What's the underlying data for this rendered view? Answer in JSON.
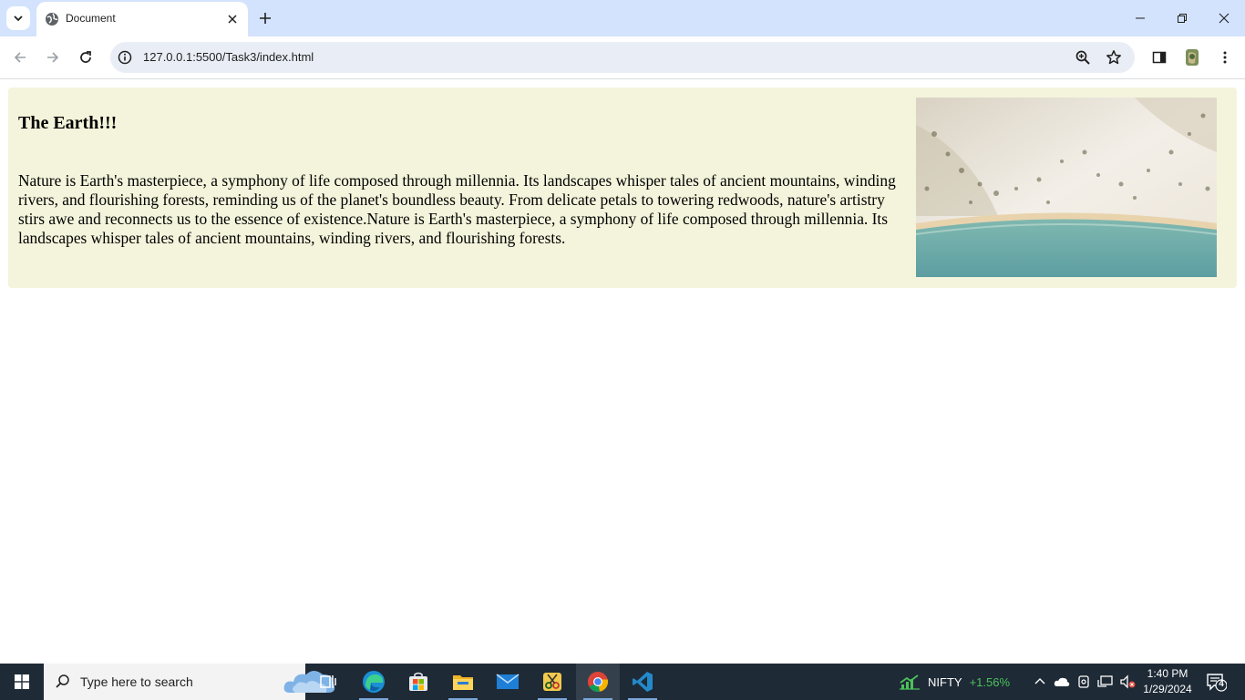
{
  "browser": {
    "tab_title": "Document",
    "url": "127.0.0.1:5500/Task3/index.html"
  },
  "page": {
    "heading": "The Earth!!!",
    "paragraph": "Nature is Earth's masterpiece, a symphony of life composed through millennia. Its landscapes whisper tales of ancient mountains, winding rivers, and flourishing forests, reminding us of the planet's boundless beauty. From delicate petals to towering redwoods, nature's artistry stirs awe and reconnects us to the essence of existence.Nature is Earth's masterpiece, a symphony of life composed through millennia. Its landscapes whisper tales of ancient mountains, winding rivers, and flourishing forests.",
    "card_background": "#f4f4dc"
  },
  "taskbar": {
    "search_placeholder": "Type here to search",
    "ticker_name": "NIFTY",
    "ticker_change": "+1.56%",
    "time": "1:40 PM",
    "date": "1/29/2024",
    "notification_count": "4",
    "apps": [
      "task-view",
      "edge",
      "microsoft-store",
      "file-explorer",
      "mail",
      "snipping-tool",
      "chrome",
      "vscode"
    ]
  },
  "colors": {
    "tabstrip": "#d3e3fd",
    "omnibox": "#e9eef6",
    "taskbar": "#1e2a36",
    "ticker_up": "#4cc15a"
  }
}
